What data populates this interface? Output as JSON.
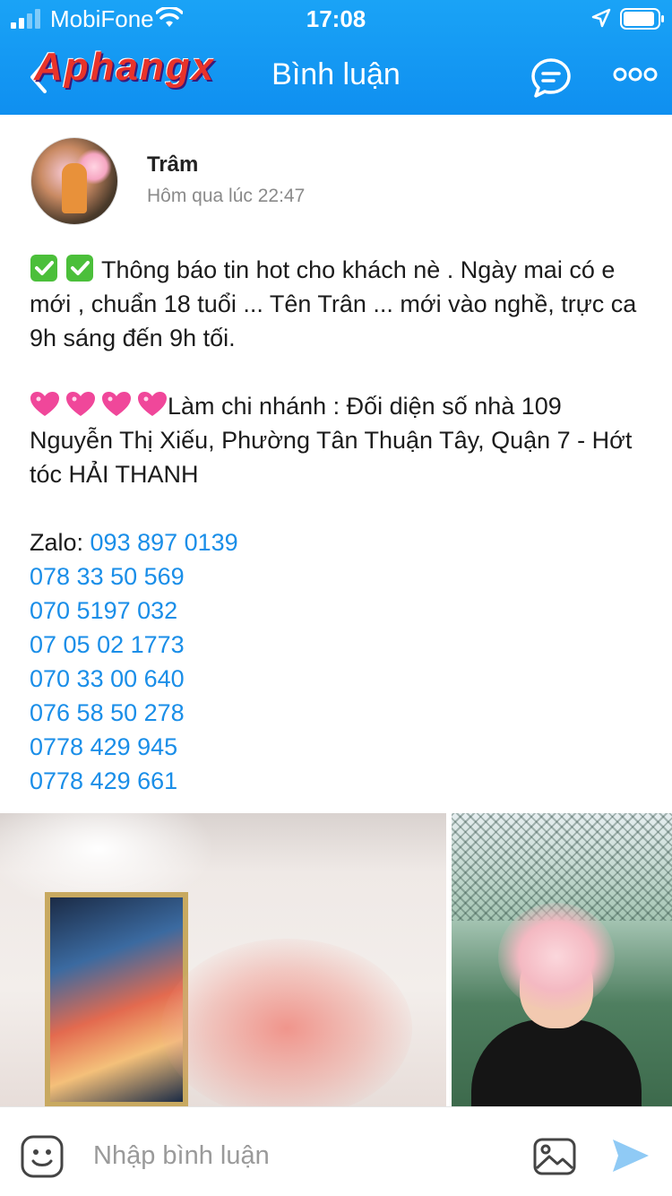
{
  "status_bar": {
    "carrier": "MobiFone",
    "time": "17:08"
  },
  "nav": {
    "title": "Bình luận",
    "watermark": "Aphangx"
  },
  "post": {
    "author": "Trâm",
    "time": "Hôm qua lúc 22:47",
    "paragraph1": "Thông báo tin hot cho khách nè . Ngày mai có e mới , chuẩn 18 tuổi ... Tên Trân ... mới vào nghề, trực ca 9h sáng đến 9h tối.",
    "paragraph2": "Làm chi nhánh : Đối diện số nhà 109 Nguyễn Thị Xiếu, Phường Tân Thuận Tây, Quận 7 - Hớt tóc HẢI THANH",
    "zalo_label": "Zalo: ",
    "phones": [
      "093 897 0139",
      "078 33 50 569",
      "070 5197 032",
      "07 05 02 1773",
      "070 33 00 640",
      "076 58 50 278",
      "0778 429 945",
      "0778 429 661"
    ]
  },
  "comment_bar": {
    "placeholder": "Nhập bình luận"
  },
  "colors": {
    "header": "#1aa3f6",
    "link": "#1a8ee8",
    "send": "#8fcaf5"
  }
}
